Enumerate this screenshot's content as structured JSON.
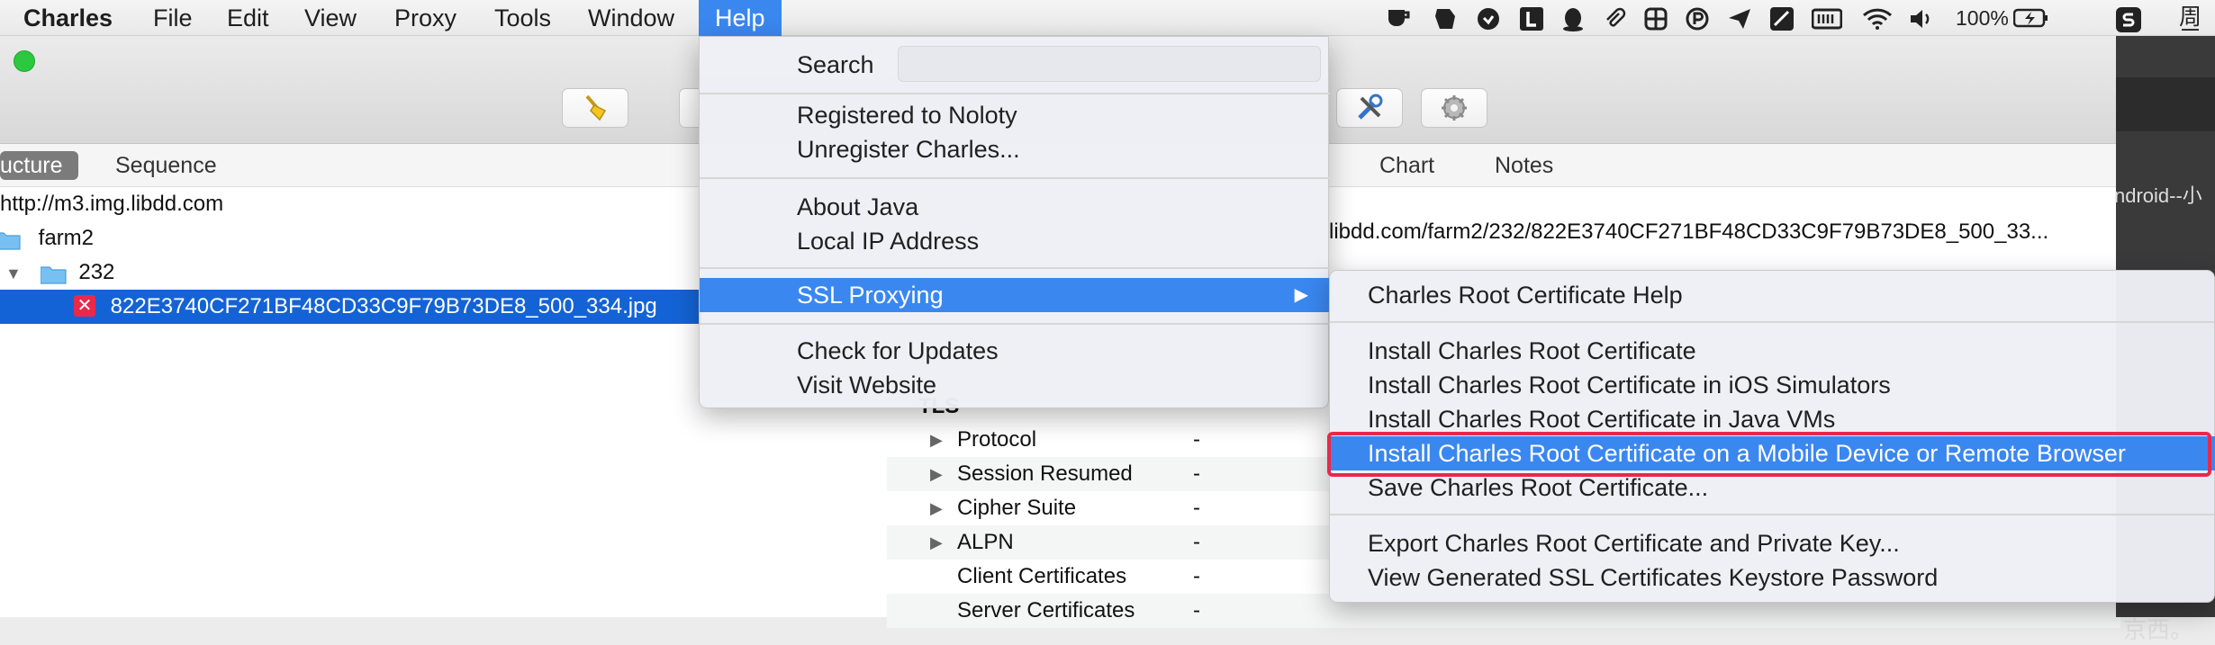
{
  "menubar": {
    "app": "Charles",
    "items": [
      "File",
      "Edit",
      "View",
      "Proxy",
      "Tools",
      "Window",
      "Help"
    ],
    "battery": "100%",
    "clock_partial": "周三"
  },
  "window": {
    "left_tabs": {
      "structure": "ucture",
      "sequence": "Sequence"
    },
    "right_tabs": {
      "chart": "Chart",
      "notes": "Notes"
    },
    "url_partial": "libdd.com/farm2/232/822E3740CF271BF48CD33C9F79B73DE8_500_33...",
    "tree": [
      {
        "label": "http://m3.img.libdd.com"
      },
      {
        "label": "farm2"
      },
      {
        "label": "232"
      },
      {
        "label": "822E3740CF271BF48CD33C9F79B73DE8_500_334.jpg"
      }
    ],
    "tls_rows": [
      {
        "key": "Protocol",
        "value": "-"
      },
      {
        "key": "Session Resumed",
        "value": "-"
      },
      {
        "key": "Cipher Suite",
        "value": "-"
      },
      {
        "key": "ALPN",
        "value": "-"
      },
      {
        "key": "Client Certificates",
        "value": "-"
      },
      {
        "key": "Server Certificates",
        "value": "-"
      }
    ]
  },
  "help_menu": {
    "search_label": "Search",
    "search_placeholder": "",
    "registered": "Registered to Noloty",
    "unregister": "Unregister Charles...",
    "about_java": "About Java",
    "local_ip": "Local IP Address",
    "ssl_proxying": "SSL Proxying",
    "check_updates": "Check for Updates",
    "visit_website": "Visit Website"
  },
  "ssl_submenu": {
    "root_help": "Charles Root Certificate Help",
    "install_root": "Install Charles Root Certificate",
    "install_ios": "Install Charles Root Certificate in iOS Simulators",
    "install_java": "Install Charles Root Certificate in Java VMs",
    "install_mobile": "Install Charles Root Certificate on a Mobile Device or Remote Browser",
    "save_root": "Save Charles Root Certificate...",
    "export_root": "Export Charles Root Certificate and Private Key...",
    "view_keystore": "View Generated SSL Certificates Keystore Password"
  },
  "dark_panel": {
    "line1": "ndroid--小",
    "line2": "京西。"
  },
  "colors": {
    "highlight": "#3a87f0",
    "selection": "#1463d6",
    "annotation_box": "#e8294a"
  }
}
